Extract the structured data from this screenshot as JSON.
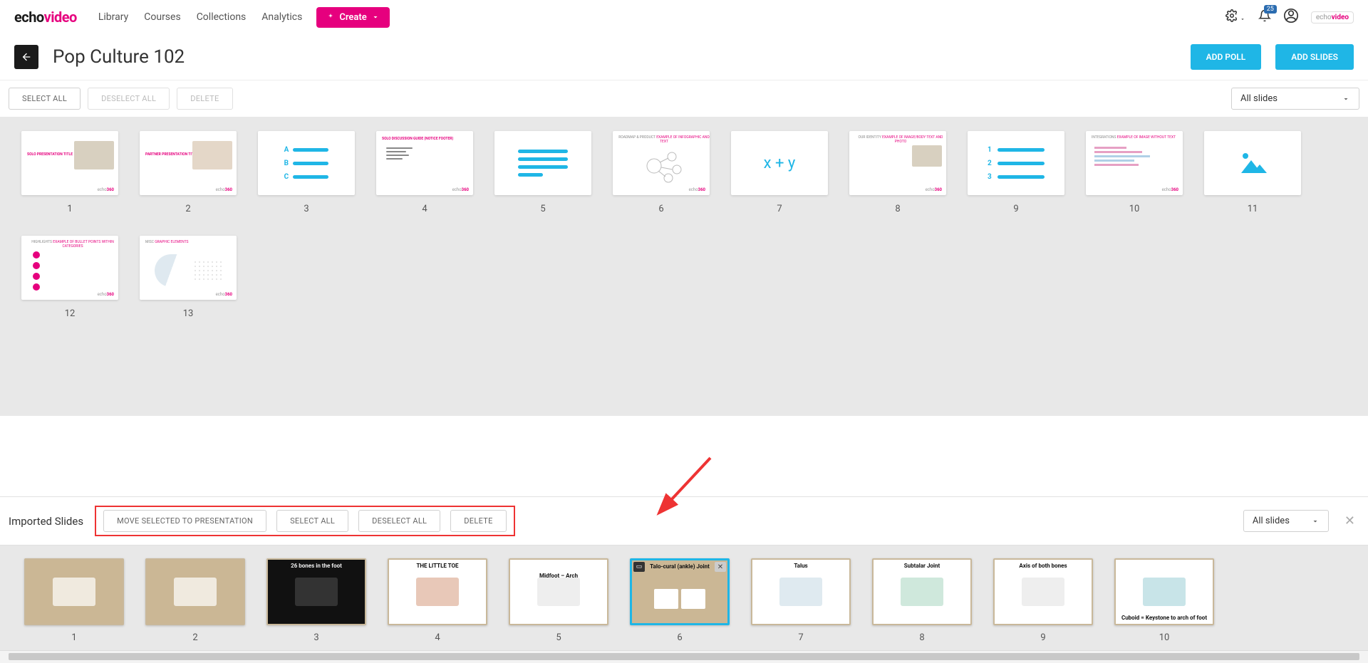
{
  "nav": {
    "logo_a": "echo",
    "logo_b": "video",
    "links": [
      "Library",
      "Courses",
      "Collections",
      "Analytics"
    ],
    "create": "Create",
    "notif_count": "25"
  },
  "page": {
    "title": "Pop Culture 102",
    "add_poll": "ADD POLL",
    "add_slides": "ADD SLIDES"
  },
  "toolbar": {
    "select_all": "SELECT ALL",
    "deselect_all": "DESELECT ALL",
    "delete": "DELETE",
    "filter": "All slides"
  },
  "slides": [
    {
      "n": "1"
    },
    {
      "n": "2"
    },
    {
      "n": "3"
    },
    {
      "n": "4"
    },
    {
      "n": "5"
    },
    {
      "n": "6"
    },
    {
      "n": "7"
    },
    {
      "n": "8"
    },
    {
      "n": "9"
    },
    {
      "n": "10"
    },
    {
      "n": "11"
    },
    {
      "n": "12"
    },
    {
      "n": "13"
    }
  ],
  "imported": {
    "title": "Imported Slides",
    "move": "MOVE SELECTED TO PRESENTATION",
    "select_all": "SELECT ALL",
    "deselect_all": "DESELECT ALL",
    "delete": "DELETE",
    "filter": "All slides",
    "items": [
      {
        "n": "1",
        "label": ""
      },
      {
        "n": "2",
        "label": ""
      },
      {
        "n": "3",
        "label": "26 bones in the foot"
      },
      {
        "n": "4",
        "label": "THE LITTLE TOE"
      },
      {
        "n": "5",
        "label": "Midfoot – Arch"
      },
      {
        "n": "6",
        "label": "Talo-cural (ankle) Joint",
        "selected": true
      },
      {
        "n": "7",
        "label": "Talus"
      },
      {
        "n": "8",
        "label": "Subtalar Joint"
      },
      {
        "n": "9",
        "label": "Axis of both bones"
      },
      {
        "n": "10",
        "label": "Cuboid = Keystone to arch of foot"
      }
    ]
  }
}
